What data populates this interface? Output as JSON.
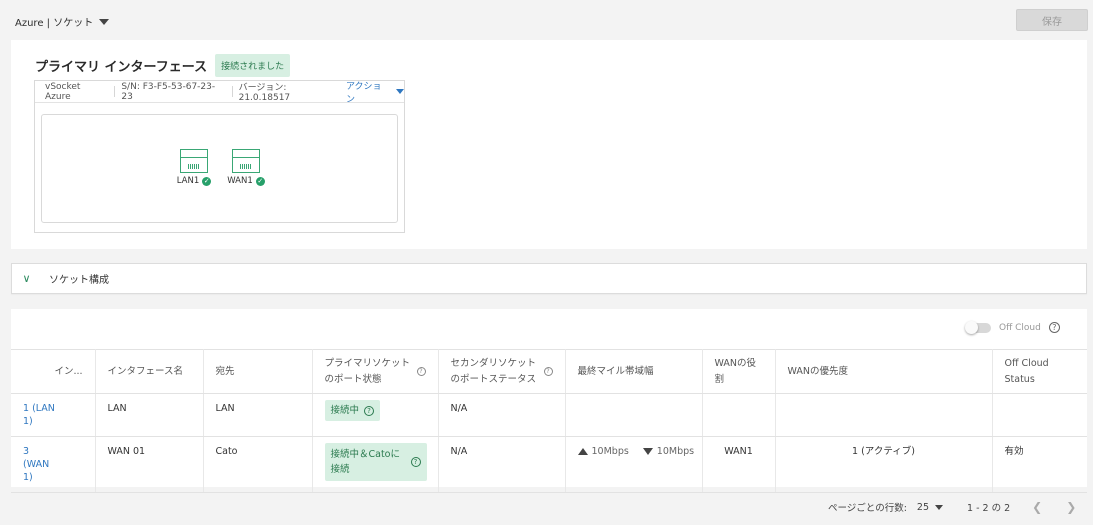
{
  "header": {
    "site_selector": "Azure | ソケット",
    "save_label": "保存"
  },
  "interface": {
    "title": "プライマリ インターフェース",
    "status_badge": "接続されました",
    "device": {
      "name": "vSocket Azure",
      "serial": "S/N: F3-F5-53-67-23-23",
      "version": "バージョン: 21.0.18517",
      "action_label": "アクション"
    },
    "ports": [
      {
        "label": "LAN1",
        "status": "connected"
      },
      {
        "label": "WAN1",
        "status": "connected"
      }
    ]
  },
  "accordion": {
    "label": "ソケット構成"
  },
  "table": {
    "off_cloud_label": "Off Cloud",
    "columns": [
      "イン...",
      "インタフェース名",
      "宛先",
      "プライマリソケットのポート状態",
      "セカンダリソケットのポートステータス",
      "最終マイル帯域幅",
      "WANの役割",
      "WANの優先度",
      "Off Cloud Status"
    ],
    "rows": [
      {
        "index": "1 (LAN 1)",
        "name": "LAN",
        "destination": "LAN",
        "primary_status": "接続中",
        "secondary_status": "N/A",
        "upload": "",
        "download": "",
        "wan_role": "",
        "wan_priority": "",
        "off_cloud_status": ""
      },
      {
        "index": "3 (WAN 1)",
        "name": "WAN 01",
        "destination": "Cato",
        "primary_status": "接続中＆Catoに接続",
        "secondary_status": "N/A",
        "upload": "10Mbps",
        "download": "10Mbps",
        "wan_role": "WAN1",
        "wan_priority": "1 (アクティブ)",
        "off_cloud_status": "有効"
      }
    ]
  },
  "pagination": {
    "rows_per_page_label": "ページごとの行数:",
    "rows_per_page_value": "25",
    "range": "1 - 2 の 2"
  },
  "colors": {
    "accent_green": "#27a06a",
    "badge_bg": "#d7efe2",
    "link_blue": "#2f77c0"
  }
}
